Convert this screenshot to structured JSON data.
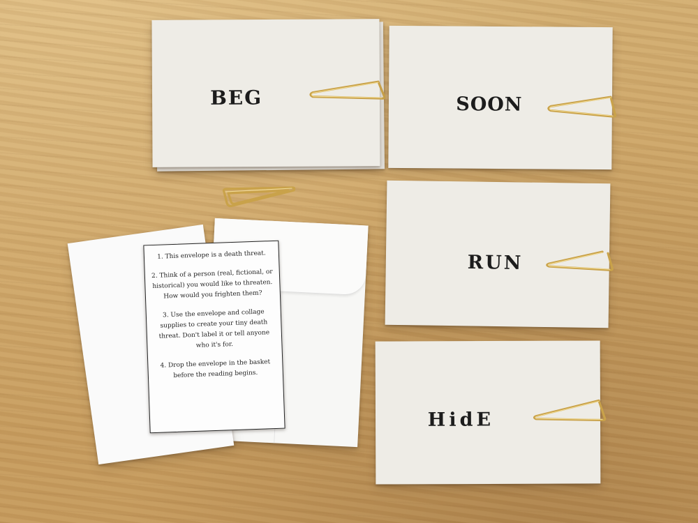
{
  "cards": [
    {
      "word": "BEG"
    },
    {
      "word": "SOON"
    },
    {
      "word": "RUN"
    },
    {
      "word": "HidE"
    }
  ],
  "instructions": [
    "1. This envelope is a death threat.",
    "2. Think of a person (real, fictional, or historical) you would like to threaten. How would you frighten them?",
    "3. Use the envelope and collage supplies to create your tiny death threat. Don't label it or tell anyone who it's for.",
    "4. Drop the envelope in the basket before the reading begins."
  ]
}
